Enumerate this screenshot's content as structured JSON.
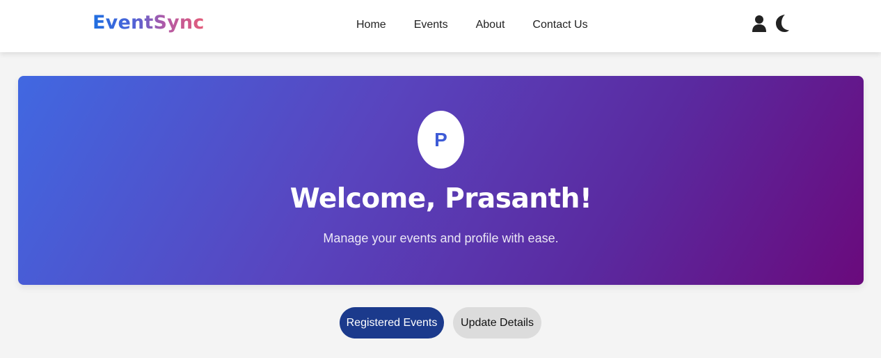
{
  "brand": {
    "name": "EventSync",
    "gradient": [
      "#1f6fe0",
      "#b25aa6",
      "#e45b78"
    ]
  },
  "nav": {
    "links": [
      "Home",
      "Events",
      "About",
      "Contact Us"
    ],
    "icons": [
      "user-icon",
      "moon-icon"
    ]
  },
  "hero": {
    "avatar_letter": "P",
    "welcome": "Welcome, Prasanth!",
    "subtitle": "Manage your events and profile with ease.",
    "gradient": [
      "#4168e1",
      "#6a0a7c"
    ]
  },
  "actions": {
    "registered_label": "Registered Events",
    "update_label": "Update Details",
    "primary_color": "#1b3a8c",
    "secondary_color": "#dcdcdc"
  }
}
